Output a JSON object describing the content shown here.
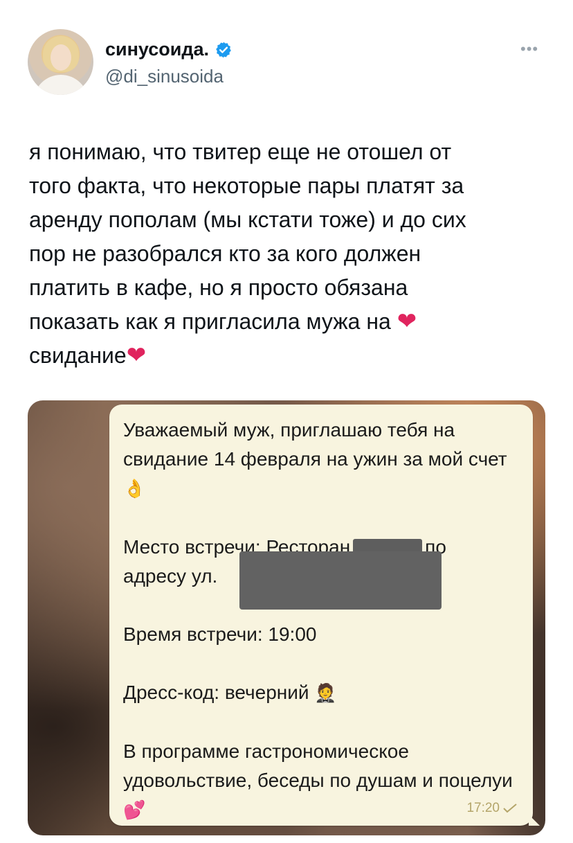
{
  "user": {
    "display_name": "синусоида.",
    "handle": "@di_sinusoida",
    "verified": true
  },
  "menu": {
    "more_label": "•••"
  },
  "tweet": {
    "text": "я понимаю, что твитер еще не отошел от\nтого факта, что некоторые пары платят за\nаренду пополам (мы кстати тоже) и до сих\nпор не разобрался кто за кого должен\nплатить в кафе, но я просто обязана\nпоказать как я пригласила мужа на",
    "text_end": "свидание"
  },
  "message": {
    "line1": "Уважаемый муж, приглашаю тебя на свидание 14 февраля на ужин за мой счет",
    "place_prefix": "Место встречи: Ресторан",
    "place_suffix": "по",
    "address_prefix": "адресу ул.",
    "time_line": "Время встречи: 19:00",
    "dress_line": "Дресс-код: вечерний",
    "program_line": "В программе гастрономическое удовольствие, беседы по душам и поцелуи",
    "timestamp": "17:20"
  },
  "icons": {
    "heart": "❤",
    "pinch": "👌",
    "tuxedo": "🤵",
    "hearts": "💕"
  },
  "colors": {
    "accent": "#1d9bf0",
    "bubble": "#f8f4df",
    "heart": "#e0245e"
  }
}
